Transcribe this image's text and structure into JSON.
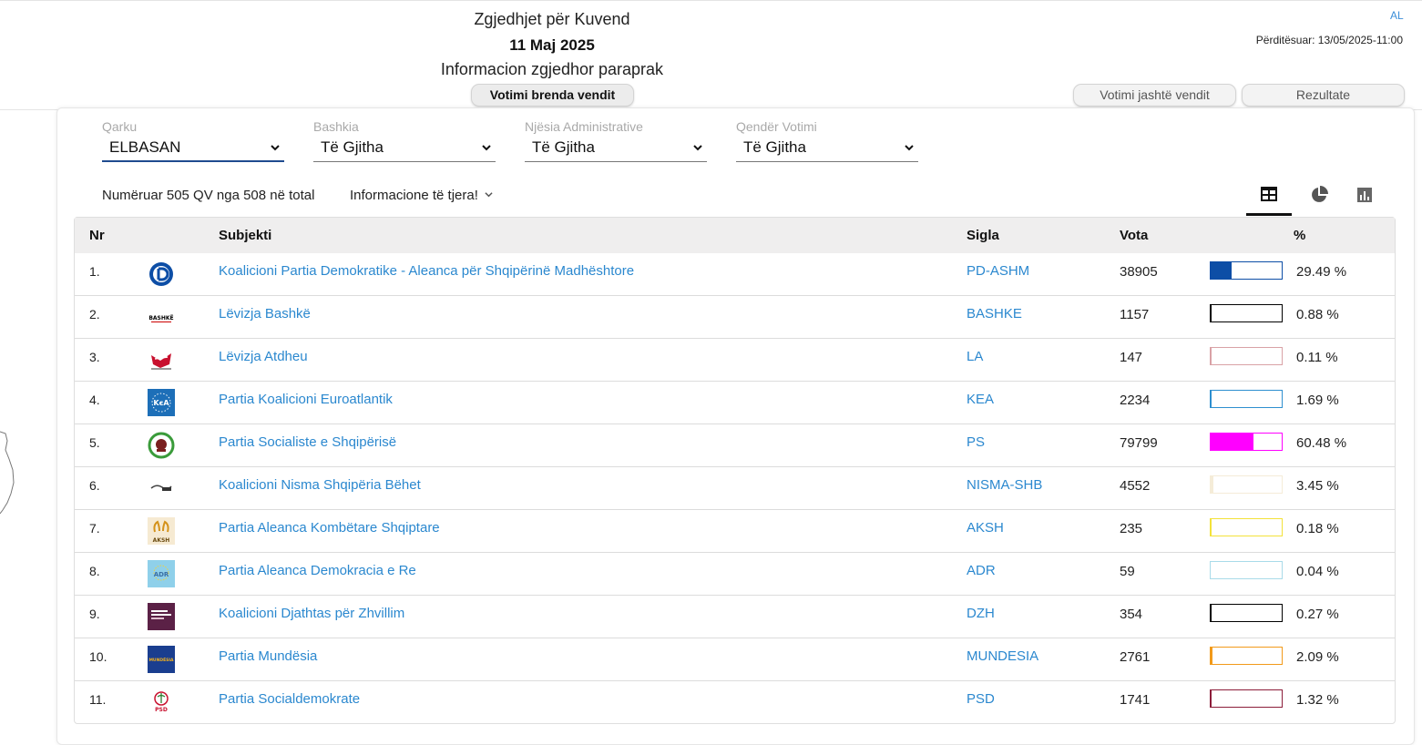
{
  "header": {
    "title_line1": "Zgjedhjet për Kuvend",
    "title_line2": "11 Maj 2025",
    "title_line3": "Informacion zgjedhor paraprak",
    "lang": "AL",
    "updated": "Përditësuar: 13/05/2025-11:00",
    "tabs": {
      "inside": "Votimi brenda vendit",
      "abroad": "Votimi jashtë vendit",
      "results": "Rezultate"
    }
  },
  "filters": {
    "qarku": {
      "label": "Qarku",
      "value": "ELBASAN"
    },
    "bashkia": {
      "label": "Bashkia",
      "value": "Të Gjitha"
    },
    "njesia": {
      "label": "Njësia Administrative",
      "value": "Të Gjitha"
    },
    "qender": {
      "label": "Qendër Votimi",
      "value": "Të Gjitha"
    }
  },
  "summary": {
    "counted": "Numëruar 505 QV nga 508 në total",
    "more_info": "Informacione të tjera!"
  },
  "view_icons": [
    "table-icon",
    "pie-chart-icon",
    "bar-chart-icon"
  ],
  "table": {
    "headers": {
      "nr": "Nr",
      "subject": "Subjekti",
      "sigla": "Sigla",
      "vota": "Vota",
      "pct": "%"
    },
    "rows": [
      {
        "nr": "1.",
        "name": "Koalicioni Partia Demokratike - Aleanca për Shqipërinë Madhështore",
        "sigla": "PD-ASHM",
        "vota": "38905",
        "pct": "29.49 %",
        "share": 0.2949,
        "color": "#0d4ea6",
        "logo": "pd-logo"
      },
      {
        "nr": "2.",
        "name": "Lëvizja Bashkë",
        "sigla": "BASHKE",
        "vota": "1157",
        "pct": "0.88 %",
        "share": 0.0088,
        "color": "#000000",
        "logo": "bashke-logo"
      },
      {
        "nr": "3.",
        "name": "Lëvizja Atdheu",
        "sigla": "LA",
        "vota": "147",
        "pct": "0.11 %",
        "share": 0.0011,
        "color": "#d9a2a6",
        "logo": "la-logo"
      },
      {
        "nr": "4.",
        "name": "Partia Koalicioni Euroatlantik",
        "sigla": "KEA",
        "vota": "2234",
        "pct": "1.69 %",
        "share": 0.0169,
        "color": "#2e8fcf",
        "logo": "kea-logo"
      },
      {
        "nr": "5.",
        "name": "Partia Socialiste e Shqipërisë",
        "sigla": "PS",
        "vota": "79799",
        "pct": "60.48 %",
        "share": 0.6048,
        "color": "#ff00ff",
        "logo": "ps-logo"
      },
      {
        "nr": "6.",
        "name": "Koalicioni Nisma Shqipëria Bëhet",
        "sigla": "NISMA-SHB",
        "vota": "4552",
        "pct": "3.45 %",
        "share": 0.0345,
        "color": "#f5ecd8",
        "logo": "nisma-logo"
      },
      {
        "nr": "7.",
        "name": "Partia Aleanca Kombëtare Shqiptare",
        "sigla": "AKSH",
        "vota": "235",
        "pct": "0.18 %",
        "share": 0.0018,
        "color": "#f3e23a",
        "logo": "aksh-logo"
      },
      {
        "nr": "8.",
        "name": "Partia Aleanca Demokracia e Re",
        "sigla": "ADR",
        "vota": "59",
        "pct": "0.04 %",
        "share": 0.0004,
        "color": "#a9dbe9",
        "logo": "adr-logo"
      },
      {
        "nr": "9.",
        "name": "Koalicioni Djathtas për Zhvillim",
        "sigla": "DZH",
        "vota": "354",
        "pct": "0.27 %",
        "share": 0.0027,
        "color": "#000000",
        "logo": "dzh-logo"
      },
      {
        "nr": "10.",
        "name": "Partia Mundësia",
        "sigla": "MUNDESIA",
        "vota": "2761",
        "pct": "2.09 %",
        "share": 0.0209,
        "color": "#f29a1a",
        "logo": "mundesia-logo"
      },
      {
        "nr": "11.",
        "name": "Partia Socialdemokrate",
        "sigla": "PSD",
        "vota": "1741",
        "pct": "1.32 %",
        "share": 0.0132,
        "color": "#8c1d3a",
        "logo": "psd-logo"
      }
    ]
  },
  "logo_texts": {
    "bashke": "BASHKË",
    "kea": "KєA",
    "aksh": "AKSH",
    "adr": "ADR",
    "mundesia": "MUNDËSIA",
    "psd": "PSD"
  }
}
